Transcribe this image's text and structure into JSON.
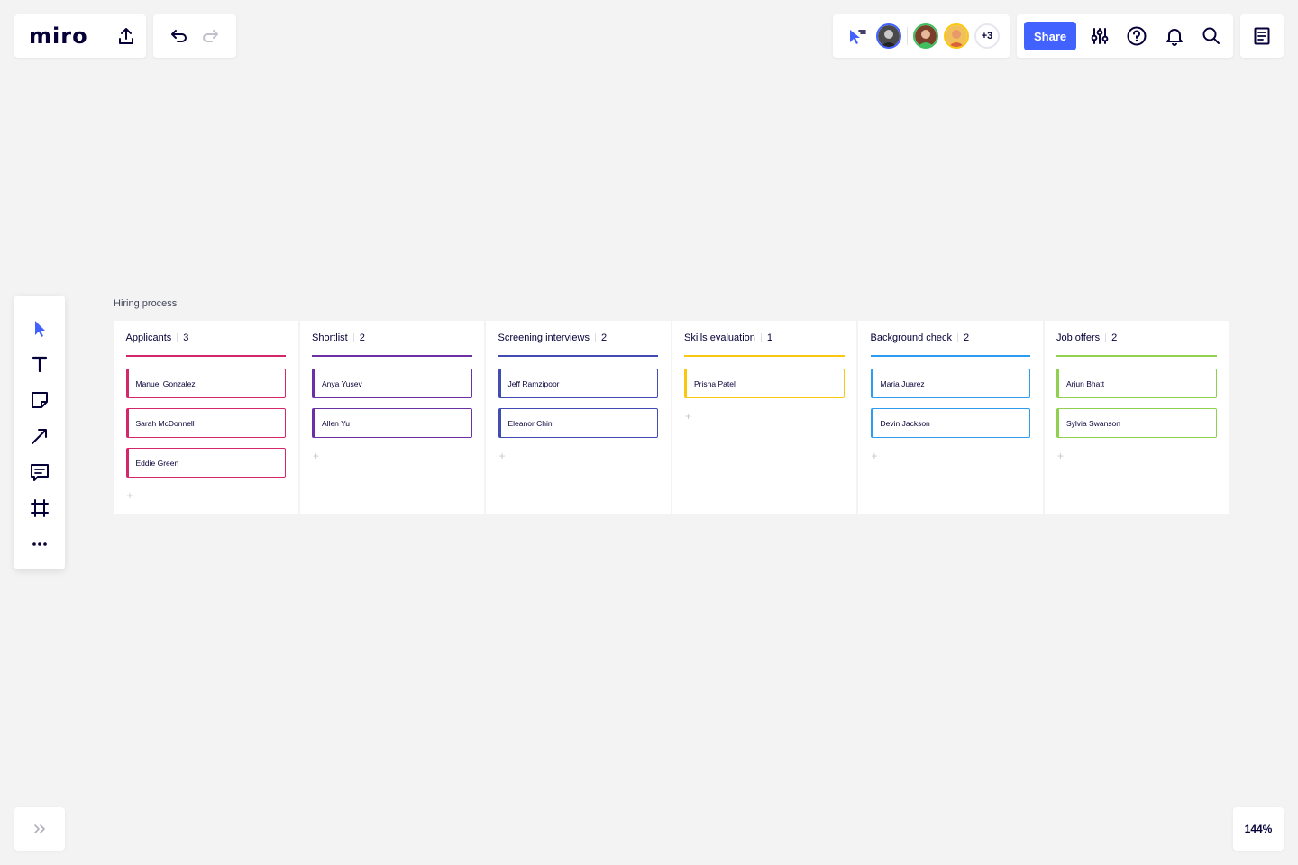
{
  "app": {
    "logo": "miro"
  },
  "collaborators": {
    "more_count": "+3",
    "avatars": [
      {
        "name": "avatar-1",
        "ring": "#4262ff",
        "fill": "#4a4a4a"
      },
      {
        "name": "avatar-2",
        "ring": "#3fbf5f",
        "fill": "#7a3f2a"
      },
      {
        "name": "avatar-3",
        "ring": "#fac710",
        "fill": "#d9643a"
      }
    ]
  },
  "toolbar": {
    "share_label": "Share"
  },
  "zoom": {
    "level": "144%"
  },
  "frame": {
    "title": "Hiring process"
  },
  "columns": [
    {
      "title": "Applicants",
      "count": "3",
      "color": "#d4276b",
      "cards": [
        "Manuel Gonzalez",
        "Sarah McDonnell",
        "Eddie Green"
      ]
    },
    {
      "title": "Shortlist",
      "count": "2",
      "color": "#6b2fa6",
      "cards": [
        "Anya Yusev",
        "Allen Yu"
      ]
    },
    {
      "title": "Screening interviews",
      "count": "2",
      "color": "#414bb2",
      "cards": [
        "Jeff Ramzipoor",
        "Eleanor Chin"
      ]
    },
    {
      "title": "Skills evaluation",
      "count": "1",
      "color": "#fac710",
      "cards": [
        "Prisha Patel"
      ]
    },
    {
      "title": "Background check",
      "count": "2",
      "color": "#2d9bf0",
      "cards": [
        "Maria Juarez",
        "Devin Jackson"
      ]
    },
    {
      "title": "Job offers",
      "count": "2",
      "color": "#8fd14f",
      "cards": [
        "Arjun Bhatt",
        "Sylvia Swanson"
      ]
    }
  ],
  "add_card_symbol": "+"
}
